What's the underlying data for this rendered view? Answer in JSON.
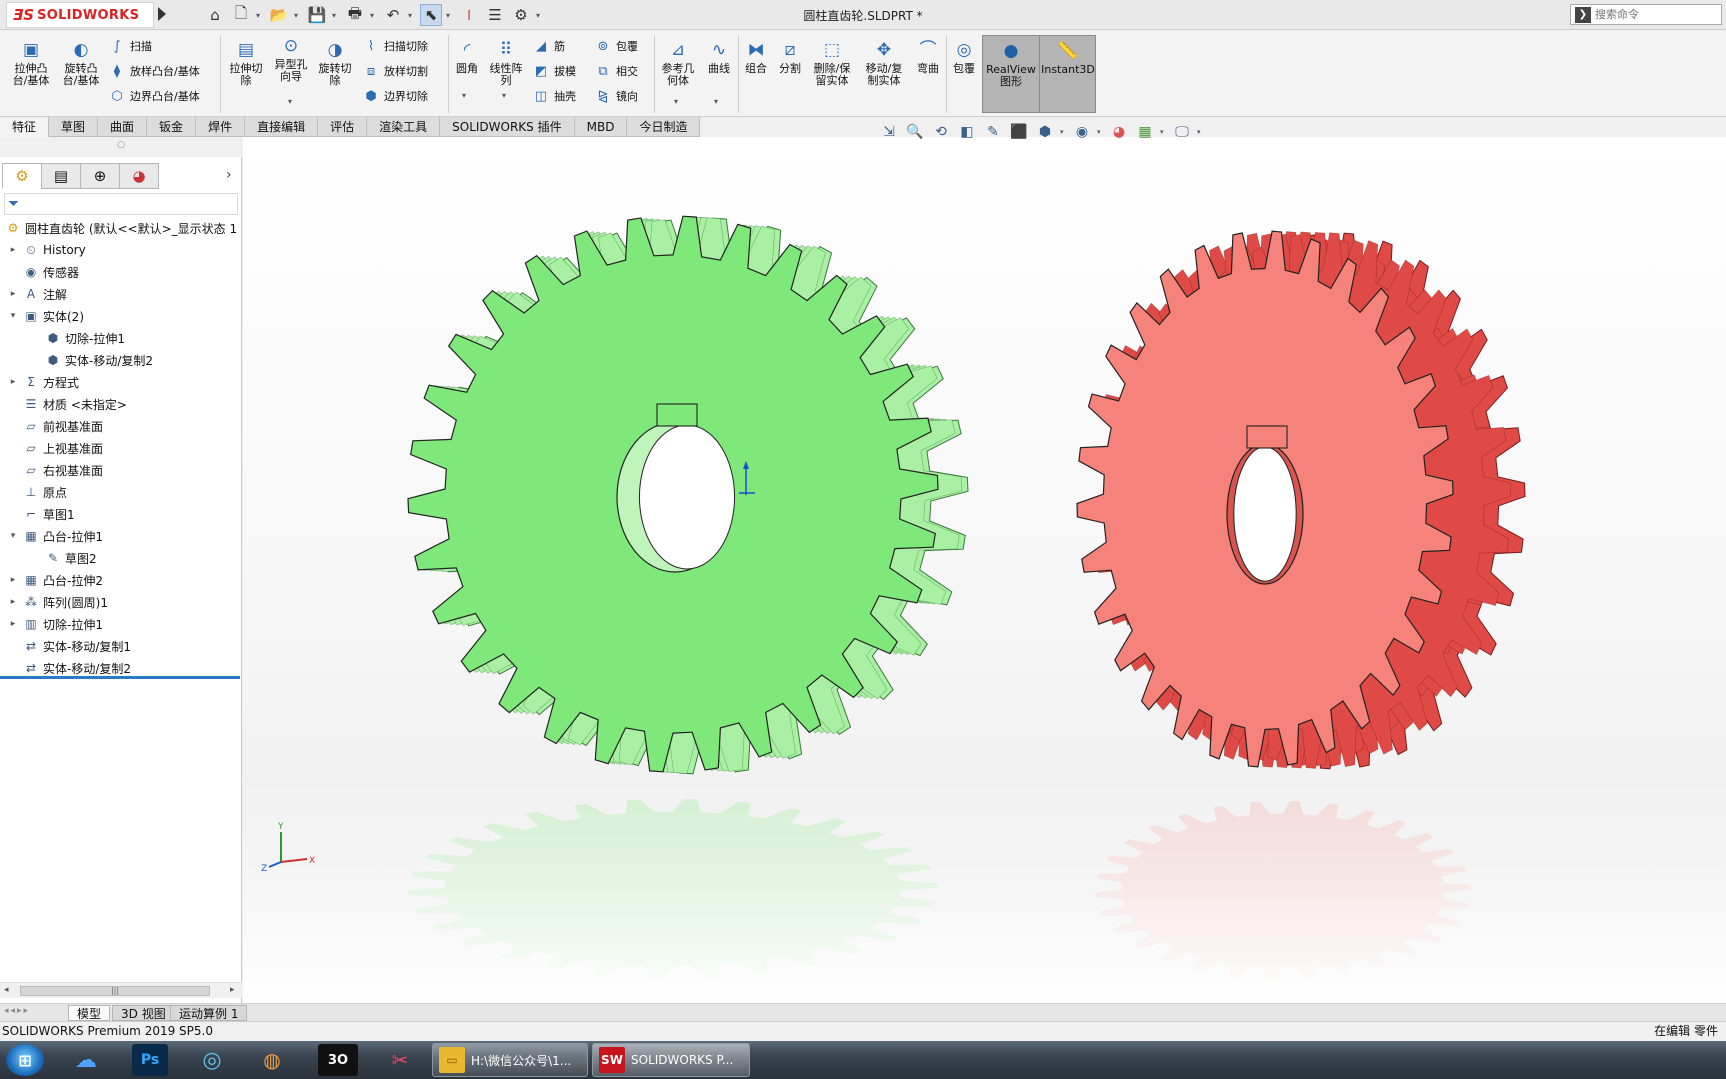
{
  "app": {
    "logo_mark": "ƎS",
    "logo_text": "SOLIDWORKS",
    "document_title": "圆柱直齿轮.SLDPRT *",
    "search_placeholder": "搜索命令"
  },
  "ribbon": {
    "extrude_boss": "拉伸凸\n台/基体",
    "revolve_boss": "旋转凸\n台/基体",
    "sweep": "扫描",
    "loft": "放样凸台/基体",
    "boundary": "边界凸台/基体",
    "extrude_cut": "拉伸切\n除",
    "hole_wizard": "异型孔\n向导",
    "revolve_cut": "旋转切\n除",
    "swept_cut": "扫描切除",
    "lofted_cut": "放样切割",
    "boundary_cut": "边界切除",
    "fillet": "圆角",
    "linear_pattern": "线性阵\n列",
    "rib": "筋",
    "draft": "拔模",
    "shell": "抽壳",
    "wrap": "包覆",
    "intersect": "相交",
    "mirror": "镜向",
    "ref_geometry": "参考几\n何体",
    "curves": "曲线",
    "combine": "组合",
    "split": "分割",
    "delete_keep": "删除/保\n留实体",
    "move_copy": "移动/复\n制实体",
    "flex": "弯曲",
    "wrap2": "包覆",
    "realview": "RealView\n图形",
    "instant3d": "Instant3D"
  },
  "tabs": [
    "特征",
    "草图",
    "曲面",
    "钣金",
    "焊件",
    "直接编辑",
    "评估",
    "渲染工具",
    "SOLIDWORKS 插件",
    "MBD",
    "今日制造"
  ],
  "active_tab": "特征",
  "feature_tree": {
    "root": "圆柱直齿轮 (默认<<默认>_显示状态 1",
    "nodes": [
      {
        "label": "History",
        "indent": 0,
        "expander": "▸",
        "icon": "history-icon",
        "glyph": "⏲"
      },
      {
        "label": "传感器",
        "indent": 0,
        "expander": "",
        "icon": "sensor-icon",
        "glyph": "◉"
      },
      {
        "label": "注解",
        "indent": 0,
        "expander": "▸",
        "icon": "annotation-icon",
        "glyph": "A"
      },
      {
        "label": "实体(2)",
        "indent": 0,
        "expander": "▾",
        "icon": "solid-bodies-icon",
        "glyph": "▣"
      },
      {
        "label": "切除-拉伸1",
        "indent": 1,
        "expander": "",
        "icon": "body-icon",
        "glyph": "⬢"
      },
      {
        "label": "实体-移动/复制2",
        "indent": 1,
        "expander": "",
        "icon": "body-icon",
        "glyph": "⬢"
      },
      {
        "label": "方程式",
        "indent": 0,
        "expander": "▸",
        "icon": "equation-icon",
        "glyph": "Σ"
      },
      {
        "label": "材质 <未指定>",
        "indent": 0,
        "expander": "",
        "icon": "material-icon",
        "glyph": "☰"
      },
      {
        "label": "前视基准面",
        "indent": 0,
        "expander": "",
        "icon": "plane-icon",
        "glyph": "▱"
      },
      {
        "label": "上视基准面",
        "indent": 0,
        "expander": "",
        "icon": "plane-icon",
        "glyph": "▱"
      },
      {
        "label": "右视基准面",
        "indent": 0,
        "expander": "",
        "icon": "plane-icon",
        "glyph": "▱"
      },
      {
        "label": "原点",
        "indent": 0,
        "expander": "",
        "icon": "origin-icon",
        "glyph": "⊥"
      },
      {
        "label": "草图1",
        "indent": 0,
        "expander": "",
        "icon": "sketch-icon",
        "glyph": "⌐"
      },
      {
        "label": "凸台-拉伸1",
        "indent": 0,
        "expander": "▾",
        "icon": "boss-extrude-icon",
        "glyph": "▦"
      },
      {
        "label": "草图2",
        "indent": 1,
        "expander": "",
        "icon": "sketch-icon",
        "glyph": "✎"
      },
      {
        "label": "凸台-拉伸2",
        "indent": 0,
        "expander": "▸",
        "icon": "boss-extrude-icon",
        "glyph": "▦"
      },
      {
        "label": "阵列(圆周)1",
        "indent": 0,
        "expander": "▸",
        "icon": "circular-pattern-icon",
        "glyph": "⁂"
      },
      {
        "label": "切除-拉伸1",
        "indent": 0,
        "expander": "▸",
        "icon": "cut-extrude-icon",
        "glyph": "▥"
      },
      {
        "label": "实体-移动/复制1",
        "indent": 0,
        "expander": "",
        "icon": "move-copy-icon",
        "glyph": "⇄"
      },
      {
        "label": "实体-移动/复制2",
        "indent": 0,
        "expander": "",
        "icon": "move-copy-icon",
        "glyph": "⇄"
      }
    ]
  },
  "bottom_tabs": [
    "模型",
    "3D 视图",
    "运动算例 1"
  ],
  "status": {
    "left": "SOLIDWORKS Premium 2019 SP5.0",
    "right": "在编辑 零件"
  },
  "taskbar": {
    "folder_window": "H:\\微信公众号\\1...",
    "sw_window": "SOLIDWORKS P..."
  },
  "viewport": {
    "gear_left_color": "#7ee87a",
    "gear_right_color": "#f5837c",
    "triad": {
      "x": "X",
      "y": "Y",
      "z": "Z"
    }
  }
}
